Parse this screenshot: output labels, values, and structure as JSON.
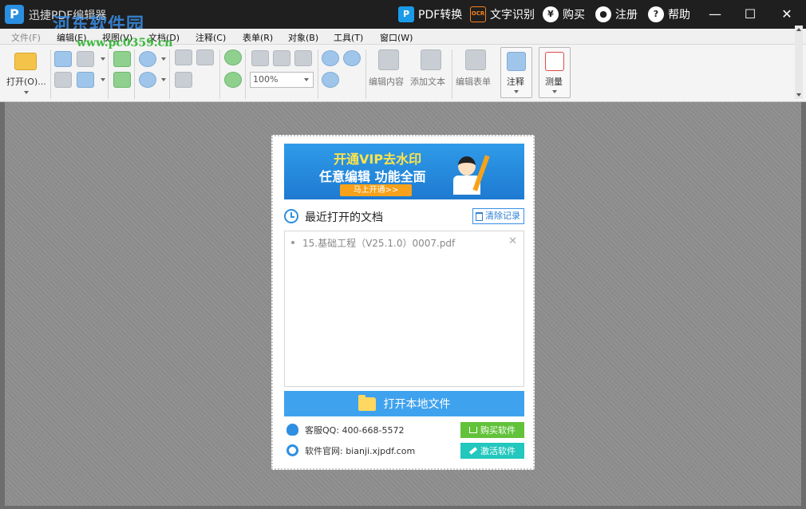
{
  "titlebar": {
    "logo_glyph": "P",
    "app_title": "迅捷PDF编辑器",
    "watermark_text": "河东软件园",
    "watermark_url": "www.pc0359.cn",
    "actions": [
      {
        "label": "PDF转换",
        "icon": "pdf-convert-icon",
        "glyph": "P"
      },
      {
        "label": "文字识别",
        "icon": "ocr-icon",
        "glyph": "OCR"
      },
      {
        "label": "购买",
        "icon": "yen-icon",
        "glyph": "¥"
      },
      {
        "label": "注册",
        "icon": "user-icon",
        "glyph": "●"
      },
      {
        "label": "帮助",
        "icon": "help-icon",
        "glyph": "?"
      }
    ],
    "window_controls": {
      "minimize": "—",
      "maximize": "☐",
      "close": "✕"
    }
  },
  "menu": {
    "items": [
      "文件(F)",
      "编辑(E)",
      "视图(V)",
      "文档(D)",
      "注释(C)",
      "表单(R)",
      "对象(B)",
      "工具(T)",
      "窗口(W)"
    ]
  },
  "toolbar": {
    "open_label": "打开(O)...",
    "zoom_value": "100%",
    "edit_content_label": "编辑内容",
    "add_text_label": "添加文本",
    "edit_form_label": "编辑表单",
    "annotate_label": "注释",
    "measure_label": "测量"
  },
  "start": {
    "banner": {
      "line1": "开通VIP去水印",
      "line2": "任意编辑  功能全面",
      "cta": "马上开通>>"
    },
    "recent_title": "最近打开的文档",
    "clear_label": "清除记录",
    "recent_files": [
      {
        "name": "15.基础工程（V25.1.0）0007.pdf",
        "remove": "✕"
      }
    ],
    "open_local_label": "打开本地文件",
    "qq_text": "客服QQ: 400-668-5572",
    "site_text": "软件官网: bianji.xjpdf.com",
    "buy_label": "购买软件",
    "activate_label": "激活软件"
  },
  "colors": {
    "titlebar": "#1f1f1f",
    "accent_blue": "#3fa2ee",
    "buy_green": "#62c23a",
    "activate_teal": "#22c7bd",
    "vip_yellow": "#ffe44a"
  }
}
